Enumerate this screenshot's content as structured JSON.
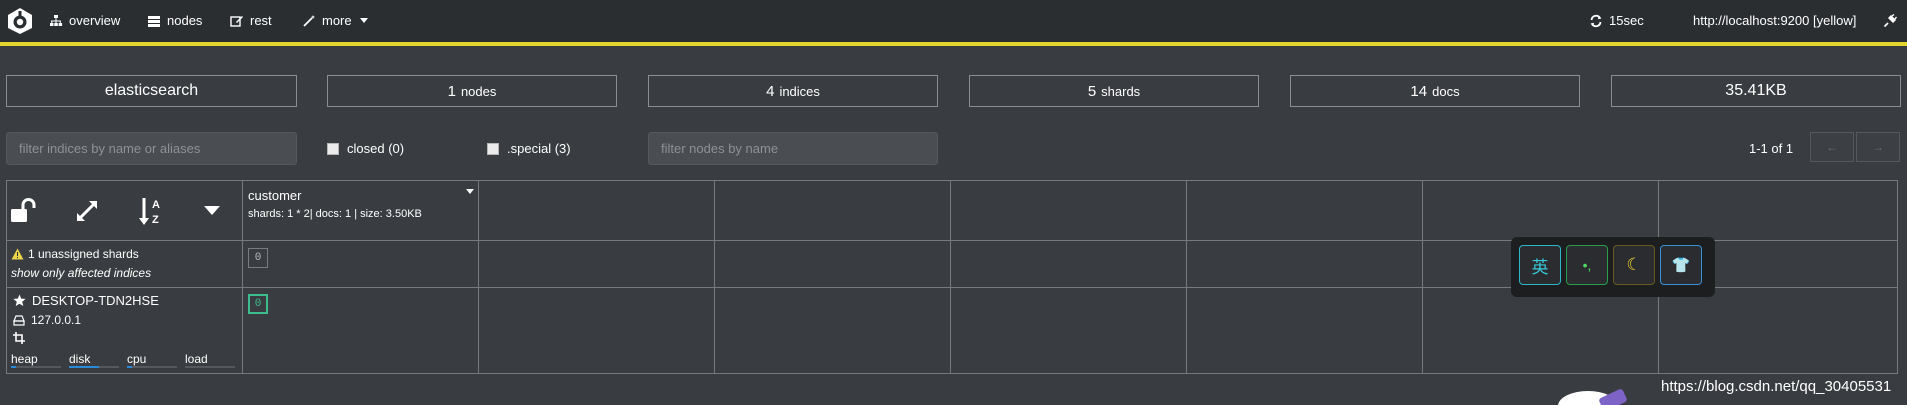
{
  "nav": {
    "items": [
      {
        "label": "overview",
        "icon": "sitemap-icon"
      },
      {
        "label": "nodes",
        "icon": "server-icon"
      },
      {
        "label": "rest",
        "icon": "edit-icon"
      },
      {
        "label": "more",
        "icon": "magic-wand-icon"
      }
    ],
    "refresh_label": "15sec",
    "cluster_url": "http://localhost:9200 [yellow]",
    "status_color": "#e3d72e"
  },
  "stats": {
    "cluster_name": "elasticsearch",
    "nodes_count": "1",
    "nodes_unit": "nodes",
    "indices_count": "4",
    "indices_unit": "indices",
    "shards_count": "5",
    "shards_unit": "shards",
    "docs_count": "14",
    "docs_unit": "docs",
    "size": "35.41KB"
  },
  "filters": {
    "indices_placeholder": "filter indices by name or aliases",
    "closed_label": "closed (0)",
    "special_label": ".special (3)",
    "nodes_placeholder": "filter nodes by name",
    "pager_text": "1-1 of 1",
    "prev_label": "←",
    "next_label": "→"
  },
  "index": {
    "name": "customer",
    "info": "shards: 1 * 2| docs: 1 | size: 3.50KB"
  },
  "unassigned": {
    "label": "1 unassigned shards",
    "link": "show only affected indices",
    "shard_number": "0"
  },
  "node": {
    "name": "DESKTOP-TDN2HSE",
    "ip": "127.0.0.1",
    "shard_number": "0",
    "metrics": [
      {
        "label": "heap",
        "fill": 0.1
      },
      {
        "label": "disk",
        "fill": 0.6
      },
      {
        "label": "cpu",
        "fill": 0.1
      },
      {
        "label": "load",
        "fill": 0
      }
    ]
  },
  "ime": {
    "keys": [
      "英",
      "•,",
      "☾",
      "👕"
    ]
  },
  "watermark": "https://blog.csdn.net/qq_30405531"
}
